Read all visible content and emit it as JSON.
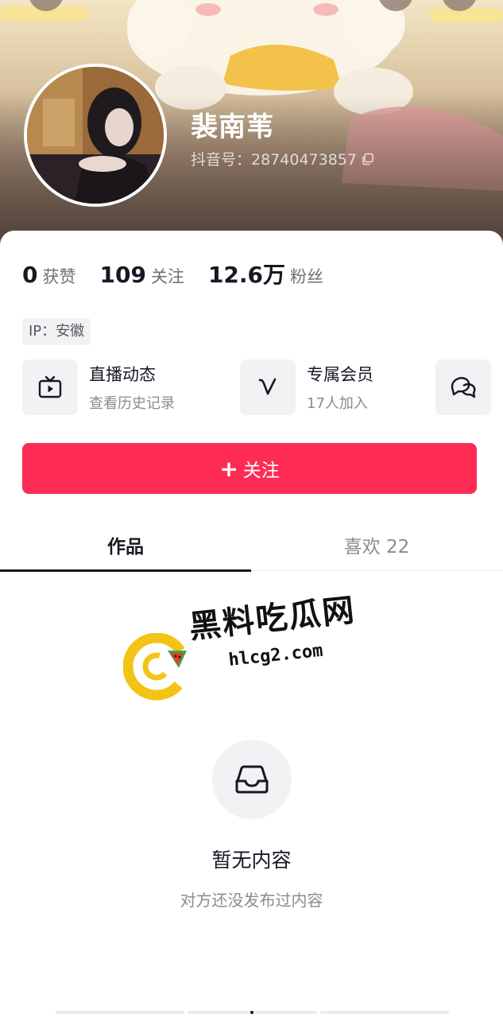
{
  "profile": {
    "nickname": "裴南苇",
    "douyin_id": "抖音号：28740473857",
    "ip": "IP：安徽"
  },
  "stats": [
    {
      "num": "0",
      "label": "获赞"
    },
    {
      "num": "109",
      "label": "关注"
    },
    {
      "num": "12.6万",
      "label": "粉丝"
    }
  ],
  "features": [
    {
      "title": "直播动态",
      "sub": "查看历史记录",
      "icon": "tv-icon"
    },
    {
      "title": "专属会员",
      "sub": "17人加入",
      "icon": "v-badge-icon"
    },
    {
      "icon": "chat-bubbles-icon"
    }
  ],
  "follow_button": {
    "plus": "+",
    "label": "关注"
  },
  "tabs": [
    {
      "label": "作品",
      "active": true
    },
    {
      "label": "喜欢 22",
      "active": false
    }
  ],
  "watermark": {
    "title": "黑料吃瓜网",
    "url": "hlcg2.com"
  },
  "empty_state": {
    "icon": "inbox-tray-icon",
    "title": "暂无内容",
    "subtitle": "对方还没发布过内容"
  },
  "colors": {
    "accent": "#fe2c55",
    "text_primary": "#161823",
    "text_secondary": "#8a8b91",
    "chip_bg": "#f2f2f4"
  }
}
